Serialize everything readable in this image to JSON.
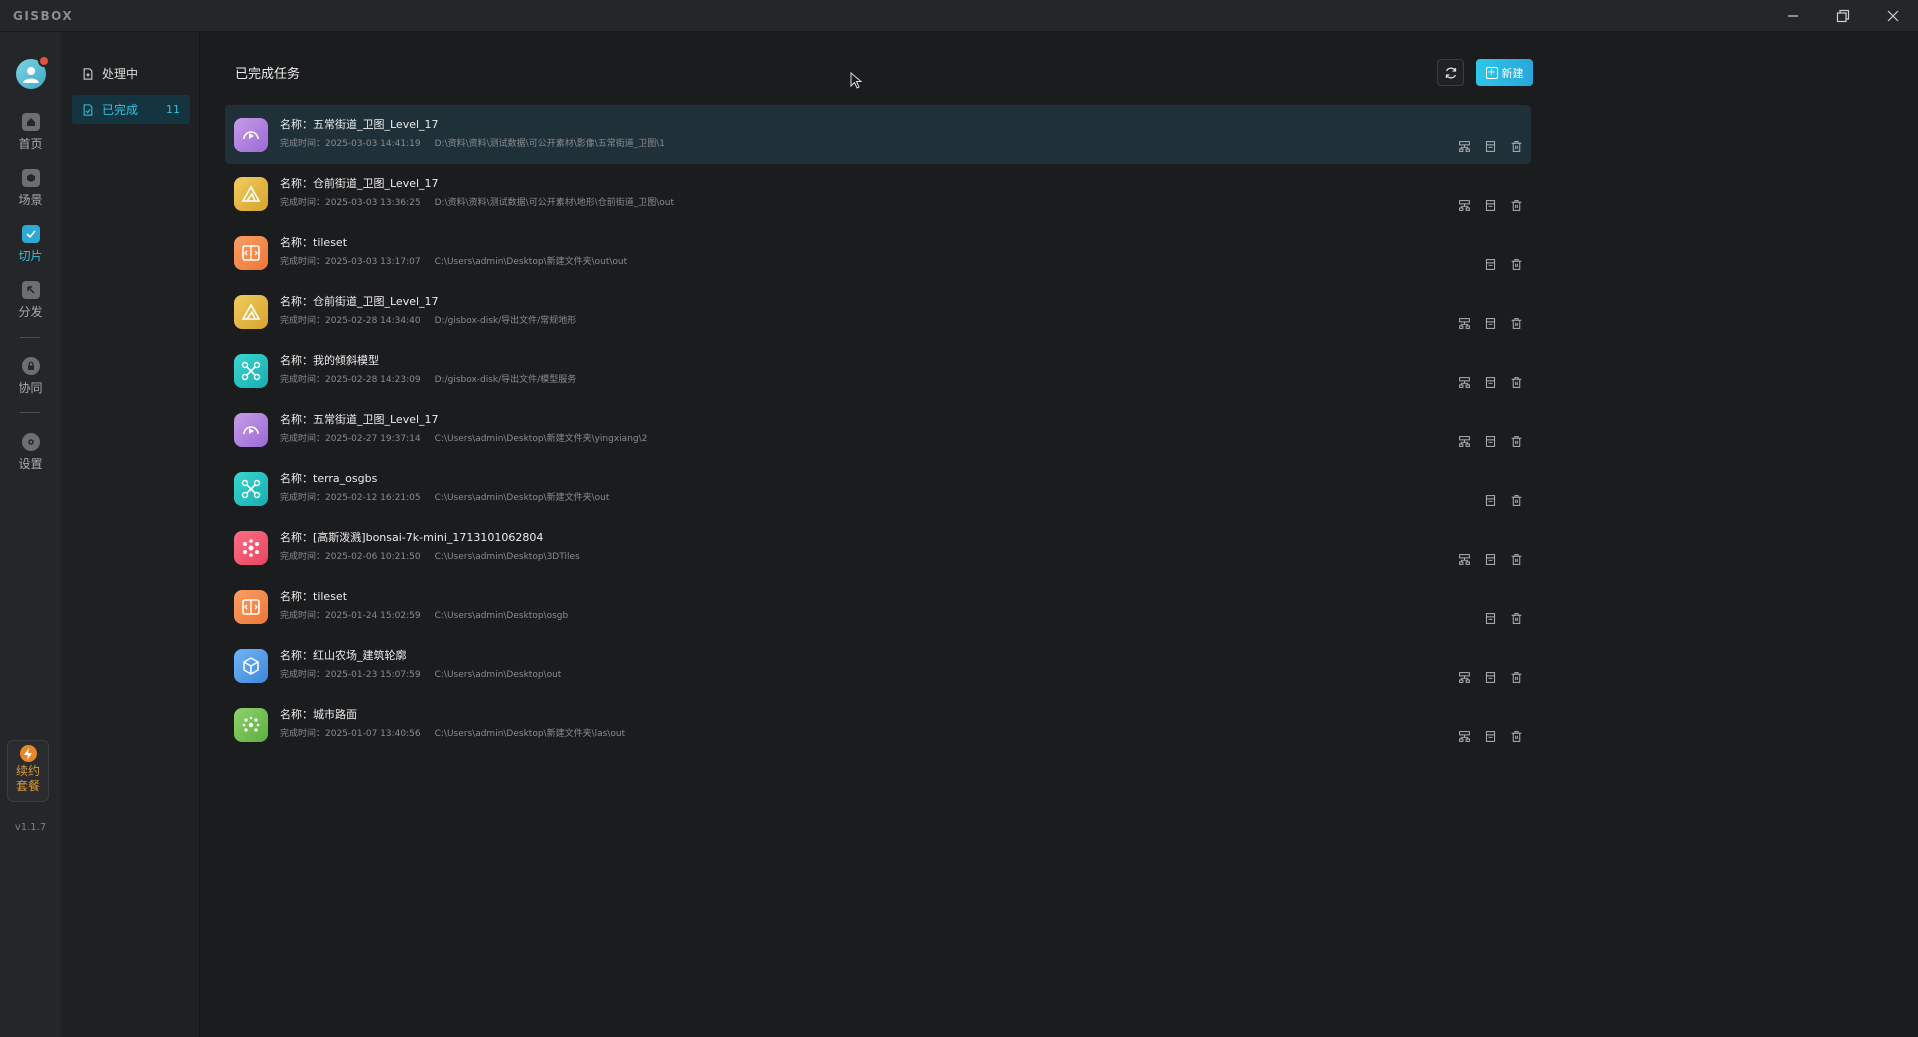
{
  "app": {
    "logo": "GISBOX",
    "version": "v1.1.7"
  },
  "window_controls": [
    "minimize-icon",
    "restore-icon",
    "close-icon"
  ],
  "rail": {
    "items": [
      {
        "label": "首页",
        "icon": "home-icon",
        "active": false
      },
      {
        "label": "场景",
        "icon": "scene-icon",
        "active": false
      },
      {
        "label": "切片",
        "icon": "tile-icon",
        "active": true
      },
      {
        "label": "分发",
        "icon": "distribute-icon",
        "active": false
      },
      {
        "label": "协同",
        "icon": "lock-icon",
        "active": false
      },
      {
        "label": "设置",
        "icon": "gear-icon",
        "active": false
      }
    ],
    "renew_line1": "续约",
    "renew_line2": "套餐"
  },
  "subnav": {
    "processing_label": "处理中",
    "completed_label": "已完成",
    "completed_count": "11"
  },
  "main": {
    "title": "已完成任务",
    "new_button": "新建",
    "name_prefix": "名称：",
    "time_prefix": "完成时间：",
    "tasks": [
      {
        "name": "五常街道_卫图_Level_17",
        "time": "2025-03-03 14:41:19",
        "path": "D:\\资料\\资料\\测试数据\\可公开素材\\影像\\五常街道_卫图\\1",
        "icon": "imagery-icon",
        "color1": "#c79ce8",
        "color2": "#9a6ad6",
        "actions": [
          "publish-icon",
          "document-icon",
          "trash-icon"
        ]
      },
      {
        "name": "仓前街道_卫图_Level_17",
        "time": "2025-03-03 13:36:25",
        "path": "D:\\资料\\资料\\测试数据\\可公开素材\\地形\\仓前街道_卫图\\out",
        "icon": "terrain-icon",
        "color1": "#f0cd5e",
        "color2": "#d6a32f",
        "actions": [
          "publish-icon",
          "document-icon",
          "trash-icon"
        ]
      },
      {
        "name": "tileset",
        "time": "2025-03-03 13:17:07",
        "path": "C:\\Users\\admin\\Desktop\\新建文件夹\\out\\out",
        "icon": "convert-icon",
        "color1": "#fb9e64",
        "color2": "#ee7636",
        "actions": [
          "document-icon",
          "trash-icon"
        ]
      },
      {
        "name": "仓前街道_卫图_Level_17",
        "time": "2025-02-28 14:34:40",
        "path": "D:/gisbox-disk/导出文件/常规地形",
        "icon": "terrain-icon",
        "color1": "#f0cd5e",
        "color2": "#d6a32f",
        "actions": [
          "publish-icon",
          "document-icon",
          "trash-icon"
        ]
      },
      {
        "name": "我的倾斜模型",
        "time": "2025-02-28 14:23:09",
        "path": "D:/gisbox-disk/导出文件/模型服务",
        "icon": "drone-icon",
        "color1": "#39d6cf",
        "color2": "#17aeb0",
        "actions": [
          "publish-icon",
          "document-icon",
          "trash-icon"
        ]
      },
      {
        "name": "五常街道_卫图_Level_17",
        "time": "2025-02-27 19:37:14",
        "path": "C:\\Users\\admin\\Desktop\\新建文件夹\\yingxiang\\2",
        "icon": "imagery-icon",
        "color1": "#c79ce8",
        "color2": "#9a6ad6",
        "actions": [
          "publish-icon",
          "document-icon",
          "trash-icon"
        ]
      },
      {
        "name": "terra_osgbs",
        "time": "2025-02-12 16:21:05",
        "path": "C:\\Users\\admin\\Desktop\\新建文件夹\\out",
        "icon": "drone-icon",
        "color1": "#39d6cf",
        "color2": "#17aeb0",
        "actions": [
          "document-icon",
          "trash-icon"
        ]
      },
      {
        "name": "[高斯泼溅]bonsai-7k-mini_1713101062804",
        "time": "2025-02-06 10:21:50",
        "path": "C:\\Users\\admin\\Desktop\\3DTiles",
        "icon": "gaussian-icon",
        "color1": "#fb6f86",
        "color2": "#e9445f",
        "actions": [
          "publish-icon",
          "document-icon",
          "trash-icon"
        ]
      },
      {
        "name": "tileset",
        "time": "2025-01-24 15:02:59",
        "path": "C:\\Users\\admin\\Desktop\\osgb",
        "icon": "convert-icon",
        "color1": "#fb9e64",
        "color2": "#ee7636",
        "actions": [
          "document-icon",
          "trash-icon"
        ]
      },
      {
        "name": "红山农场_建筑轮廓",
        "time": "2025-01-23 15:07:59",
        "path": "C:\\Users\\admin\\Desktop\\out",
        "icon": "cube-icon",
        "color1": "#6fb6f4",
        "color2": "#3f86dd",
        "actions": [
          "publish-icon",
          "document-icon",
          "trash-icon"
        ]
      },
      {
        "name": "城市路面",
        "time": "2025-01-07 13:40:56",
        "path": "C:\\Users\\admin\\Desktop\\新建文件夹\\las\\out",
        "icon": "pointcloud-icon",
        "color1": "#8dd36b",
        "color2": "#5cae40",
        "actions": [
          "publish-icon",
          "document-icon",
          "trash-icon"
        ]
      }
    ]
  }
}
